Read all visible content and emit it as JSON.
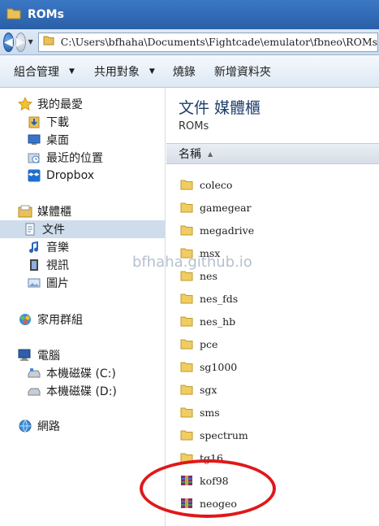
{
  "window": {
    "title": "ROMs"
  },
  "address": {
    "path": "C:\\Users\\bfhaha\\Documents\\Fightcade\\emulator\\fbneo\\ROMs"
  },
  "toolbar": {
    "organize": "組合管理",
    "share": "共用對象",
    "burn": "燒錄",
    "new_folder": "新增資料夾"
  },
  "sidebar": {
    "favorites": {
      "label": "我的最愛",
      "items": [
        {
          "label": "下載",
          "icon": "download-folder-icon"
        },
        {
          "label": "桌面",
          "icon": "desktop-icon"
        },
        {
          "label": "最近的位置",
          "icon": "recent-places-icon"
        },
        {
          "label": "Dropbox",
          "icon": "dropbox-icon"
        }
      ]
    },
    "libraries": {
      "label": "媒體櫃",
      "items": [
        {
          "label": "文件",
          "icon": "documents-icon",
          "selected": true
        },
        {
          "label": "音樂",
          "icon": "music-icon"
        },
        {
          "label": "視訊",
          "icon": "video-icon"
        },
        {
          "label": "圖片",
          "icon": "pictures-icon"
        }
      ]
    },
    "homegroup": {
      "label": "家用群組"
    },
    "computer": {
      "label": "電腦",
      "items": [
        {
          "label": "本機磁碟 (C:)",
          "icon": "drive-c-icon"
        },
        {
          "label": "本機磁碟 (D:)",
          "icon": "drive-d-icon"
        }
      ]
    },
    "network": {
      "label": "網路"
    }
  },
  "library": {
    "title": "文件 媒體櫃",
    "subtitle": "ROMs",
    "column_name": "名稱"
  },
  "files": [
    {
      "name": "coleco",
      "type": "folder"
    },
    {
      "name": "gamegear",
      "type": "folder"
    },
    {
      "name": "megadrive",
      "type": "folder"
    },
    {
      "name": "msx",
      "type": "folder"
    },
    {
      "name": "nes",
      "type": "folder"
    },
    {
      "name": "nes_fds",
      "type": "folder"
    },
    {
      "name": "nes_hb",
      "type": "folder"
    },
    {
      "name": "pce",
      "type": "folder"
    },
    {
      "name": "sg1000",
      "type": "folder"
    },
    {
      "name": "sgx",
      "type": "folder"
    },
    {
      "name": "sms",
      "type": "folder"
    },
    {
      "name": "spectrum",
      "type": "folder"
    },
    {
      "name": "tg16",
      "type": "folder"
    },
    {
      "name": "kof98",
      "type": "archive"
    },
    {
      "name": "neogeo",
      "type": "archive"
    }
  ],
  "watermark": "bfhaha.github.io",
  "colors": {
    "highlight": "#e0181a",
    "titlebar": "#2a5fa8",
    "selection": "#cfdceb"
  }
}
